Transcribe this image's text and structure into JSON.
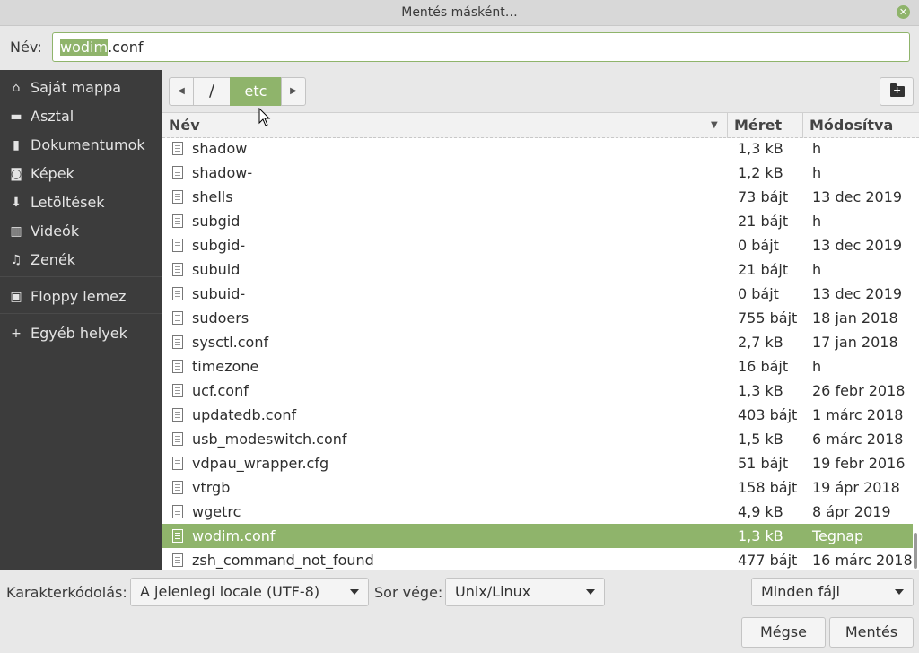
{
  "window": {
    "title": "Mentés másként…"
  },
  "name_row": {
    "label": "Név:",
    "value_selected": "wodim",
    "value_rest": ".conf"
  },
  "sidebar": {
    "items": [
      {
        "label": "Saját mappa",
        "icon": "home-icon",
        "glyph": "⌂"
      },
      {
        "label": "Asztal",
        "icon": "desktop-icon",
        "glyph": "▬"
      },
      {
        "label": "Dokumentumok",
        "icon": "document-icon",
        "glyph": "▮"
      },
      {
        "label": "Képek",
        "icon": "camera-icon",
        "glyph": "◙"
      },
      {
        "label": "Letöltések",
        "icon": "download-icon",
        "glyph": "⬇"
      },
      {
        "label": "Videók",
        "icon": "film-icon",
        "glyph": "▥"
      },
      {
        "label": "Zenék",
        "icon": "music-icon",
        "glyph": "♫"
      },
      {
        "label": "Floppy lemez",
        "icon": "floppy-icon",
        "glyph": "▣"
      },
      {
        "label": "Egyéb helyek",
        "icon": "plus-icon",
        "glyph": "+"
      }
    ]
  },
  "pathbar": {
    "back_glyph": "◀",
    "forward_glyph": "▶",
    "root_label": "/",
    "current_label": "etc"
  },
  "columns": {
    "name": "Név",
    "size": "Méret",
    "modified": "Módosítva",
    "sort_glyph": "▼"
  },
  "files": [
    {
      "name": "shadow",
      "size": "1,3 kB",
      "modified": "h"
    },
    {
      "name": "shadow-",
      "size": "1,2 kB",
      "modified": "h"
    },
    {
      "name": "shells",
      "size": "73 bájt",
      "modified": "13 dec 2019"
    },
    {
      "name": "subgid",
      "size": "21 bájt",
      "modified": "h"
    },
    {
      "name": "subgid-",
      "size": "0 bájt",
      "modified": "13 dec 2019"
    },
    {
      "name": "subuid",
      "size": "21 bájt",
      "modified": "h"
    },
    {
      "name": "subuid-",
      "size": "0 bájt",
      "modified": "13 dec 2019"
    },
    {
      "name": "sudoers",
      "size": "755 bájt",
      "modified": "18 jan 2018"
    },
    {
      "name": "sysctl.conf",
      "size": "2,7 kB",
      "modified": "17 jan 2018"
    },
    {
      "name": "timezone",
      "size": "16 bájt",
      "modified": "h"
    },
    {
      "name": "ucf.conf",
      "size": "1,3 kB",
      "modified": "26 febr 2018"
    },
    {
      "name": "updatedb.conf",
      "size": "403 bájt",
      "modified": "1 márc 2018"
    },
    {
      "name": "usb_modeswitch.conf",
      "size": "1,5 kB",
      "modified": "6 márc 2018"
    },
    {
      "name": "vdpau_wrapper.cfg",
      "size": "51 bájt",
      "modified": "19 febr 2016"
    },
    {
      "name": "vtrgb",
      "size": "158 bájt",
      "modified": "19 ápr 2018"
    },
    {
      "name": "wgetrc",
      "size": "4,9 kB",
      "modified": "8 ápr 2019"
    },
    {
      "name": "wodim.conf",
      "size": "1,3 kB",
      "modified": "Tegnap",
      "selected": true
    },
    {
      "name": "zsh_command_not_found",
      "size": "477 bájt",
      "modified": "16 márc 2018"
    }
  ],
  "bottom": {
    "encoding_label": "Karakterkódolás:",
    "encoding_value": "A jelenlegi locale (UTF-8)",
    "line_end_label": "Sor vége:",
    "line_end_value": "Unix/Linux",
    "filter_value": "Minden fájl",
    "cancel_label": "Mégse",
    "save_label": "Mentés"
  },
  "colors": {
    "accent": "#8fb46b",
    "sidebar_bg": "#3c3c3c"
  }
}
